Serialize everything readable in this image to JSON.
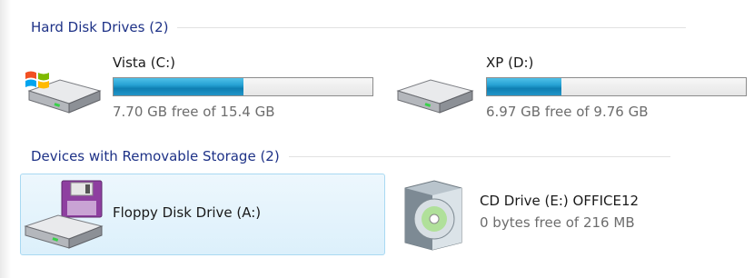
{
  "groups": {
    "hard_disks": {
      "title": "Hard Disk Drives (2)"
    },
    "removable": {
      "title": "Devices with Removable Storage (2)"
    }
  },
  "drives": {
    "vista": {
      "name": "Vista (C:)",
      "free": "7.70 GB free of 15.4 GB",
      "used_fraction": 0.5,
      "icon": "hard-drive-windows-icon"
    },
    "xp": {
      "name": "XP (D:)",
      "free": "6.97 GB free of 9.76 GB",
      "used_fraction": 0.286,
      "icon": "hard-drive-icon"
    },
    "floppy": {
      "name": "Floppy Disk Drive (A:)",
      "icon": "floppy-drive-icon",
      "selected": true
    },
    "cd": {
      "name": "CD Drive (E:) OFFICE12",
      "free": "0 bytes free of 216 MB",
      "icon": "cd-drive-icon"
    }
  },
  "colors": {
    "group_header": "#1e3287",
    "bar_fill": "#26a1d3",
    "selection": "#dcf0fb"
  }
}
